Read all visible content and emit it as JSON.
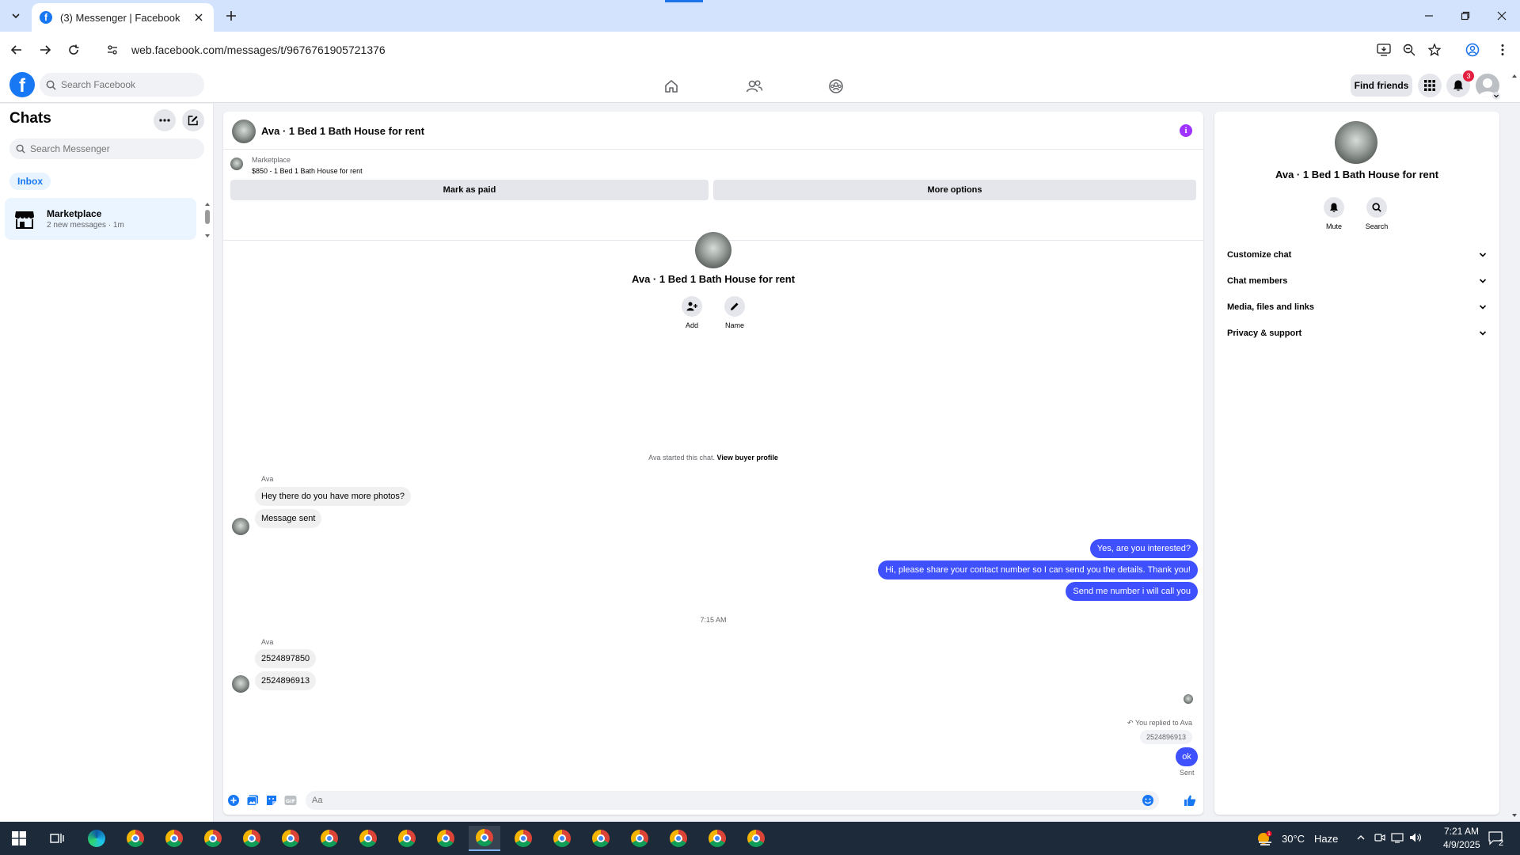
{
  "browser": {
    "tab_title": "(3) Messenger | Facebook",
    "url": "web.facebook.com/messages/t/9676761905721376"
  },
  "fb": {
    "search_placeholder": "Search Facebook",
    "find_friends": "Find friends",
    "notification_count": "3"
  },
  "left": {
    "title": "Chats",
    "search_placeholder": "Search Messenger",
    "inbox_label": "Inbox",
    "conversations": [
      {
        "name": "Marketplace",
        "preview": "2 new messages · 1m"
      }
    ]
  },
  "chat": {
    "title": "Ava · 1 Bed 1 Bath House for rent",
    "marketplace_label": "Marketplace",
    "listing": "$850 - 1 Bed 1 Bath House for rent",
    "mark_paid": "Mark as paid",
    "more_options": "More options",
    "add_label": "Add",
    "name_label": "Name",
    "started_text": "Ava started this chat.",
    "view_profile": "View buyer profile",
    "sender_name": "Ava",
    "msg_in_1": "Hey there do you have more photos?",
    "msg_in_2": "Message sent",
    "msg_out_1": "Yes, are you interested?",
    "msg_out_2": "Hi, please share your contact number so I can send you the details. Thank you!",
    "msg_out_3": "Send me number i will call you",
    "time_sep": "7:15 AM",
    "msg_in_3": "2524897850",
    "msg_in_4": "2524896913",
    "replied_to": "You replied to Ava",
    "quoted": "2524896913",
    "msg_out_4": "ok",
    "sent_status": "Sent",
    "composer_placeholder": "Aa"
  },
  "right": {
    "title": "Ava · 1 Bed 1 Bath House for rent",
    "mute": "Mute",
    "search": "Search",
    "sections": [
      "Customize chat",
      "Chat members",
      "Media, files and links",
      "Privacy & support"
    ]
  },
  "taskbar": {
    "temperature": "30°C",
    "weather": "Haze",
    "time": "7:21 AM",
    "date": "4/9/2025",
    "notif_count": "2"
  },
  "colors": {
    "fb_blue": "#1877f2",
    "outgoing_bubble": "#3f51ff",
    "incoming_bubble": "#f0f0f0",
    "info_icon": "#a033ff"
  }
}
